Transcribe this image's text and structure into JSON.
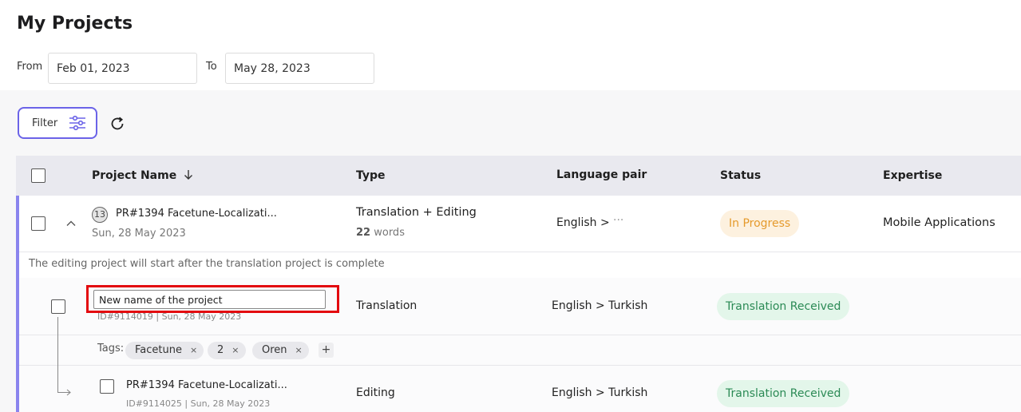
{
  "page": {
    "title": "My Projects"
  },
  "date_range": {
    "from_label": "From",
    "from_value": "Feb 01, 2023",
    "to_label": "To",
    "to_value": "May 28, 2023"
  },
  "toolbar": {
    "filter_label": "Filter"
  },
  "table": {
    "columns": [
      "Project Name",
      "Type",
      "Language pair",
      "Status",
      "Expertise"
    ],
    "parent_row": {
      "count": "13",
      "name": "PR#1394 Facetune-Localizati...",
      "date": "Sun, 28 May 2023",
      "type": "Translation + Editing",
      "word_count": "22",
      "word_unit": "words",
      "language": "English >",
      "more": "···",
      "status": "In Progress",
      "expertise": "Mobile Applications"
    },
    "note": "The editing project will start after the translation project is complete",
    "child_rows": [
      {
        "name_input_value": "New name of the project",
        "meta": "ID#9114019 | Sun, 28 May 2023",
        "type": "Translation",
        "language": "English > Turkish",
        "status": "Translation Received"
      },
      {
        "name": "PR#1394 Facetune-Localizati...",
        "meta": "ID#9114025 | Sun, 28 May 2023",
        "type": "Editing",
        "language": "English > Turkish",
        "status": "Translation Received"
      }
    ],
    "tags": {
      "label": "Tags:",
      "items": [
        "Facetune",
        "2",
        "Oren"
      ],
      "remove_glyph": "×",
      "add_glyph": "+"
    }
  },
  "colors": {
    "accent": "#6b63e8",
    "in_progress": "#e59a2c",
    "received": "#2b8a55",
    "highlight": "#e3090f"
  }
}
